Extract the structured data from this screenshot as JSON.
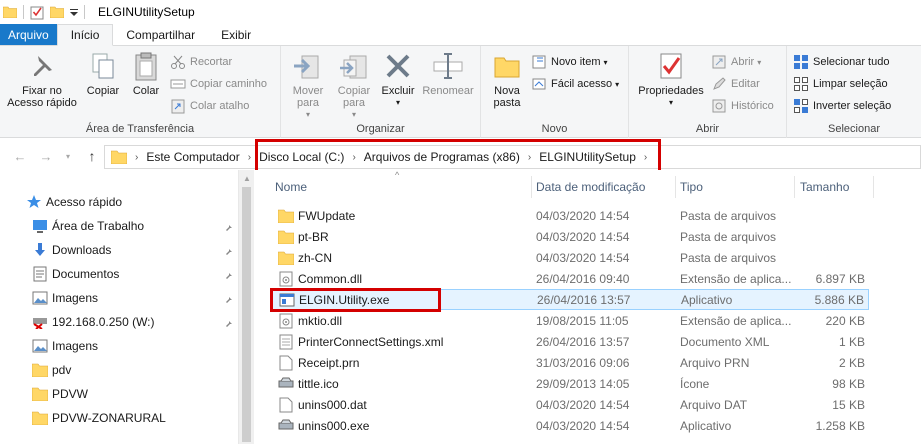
{
  "window": {
    "title": "ELGINUtilitySetup"
  },
  "tabs": [
    {
      "label": "Arquivo"
    },
    {
      "label": "Início"
    },
    {
      "label": "Compartilhar"
    },
    {
      "label": "Exibir"
    }
  ],
  "ribbon": {
    "clipboard": {
      "label": "Área de Transferência",
      "pin_label": "Fixar no Acesso rápido",
      "copy_label": "Copiar",
      "paste_label": "Colar",
      "cut_label": "Recortar",
      "copy_path_label": "Copiar caminho",
      "paste_shortcut_label": "Colar atalho"
    },
    "organize": {
      "label": "Organizar",
      "move_label": "Mover para",
      "copy_to_label": "Copiar para",
      "delete_label": "Excluir",
      "rename_label": "Renomear"
    },
    "new": {
      "label": "Novo",
      "new_folder_label": "Nova pasta",
      "new_item_label": "Novo item",
      "easy_access_label": "Fácil acesso"
    },
    "open": {
      "label": "Abrir",
      "properties_label": "Propriedades",
      "open_label": "Abrir",
      "edit_label": "Editar",
      "history_label": "Histórico"
    },
    "select": {
      "label": "Selecionar",
      "select_all_label": "Selecionar tudo",
      "select_none_label": "Limpar seleção",
      "invert_label": "Inverter seleção"
    }
  },
  "address": {
    "crumbs": [
      "Este Computador",
      "Disco Local (C:)",
      "Arquivos de Programas (x86)",
      "ELGINUtilitySetup"
    ]
  },
  "nav": {
    "quick_access": "Acesso rápido",
    "items": [
      {
        "label": "Área de Trabalho",
        "icon": "desktop-icon",
        "pinned": true
      },
      {
        "label": "Downloads",
        "icon": "download-icon",
        "pinned": true
      },
      {
        "label": "Documentos",
        "icon": "documents-icon",
        "pinned": true
      },
      {
        "label": "Imagens",
        "icon": "pictures-icon",
        "pinned": true
      },
      {
        "label": "192.168.0.250 (W:)",
        "icon": "network-drive-icon",
        "pinned": true
      },
      {
        "label": "Imagens",
        "icon": "pictures-icon",
        "pinned": false
      },
      {
        "label": "pdv",
        "icon": "folder-icon",
        "pinned": false
      },
      {
        "label": "PDVW",
        "icon": "folder-icon",
        "pinned": false
      },
      {
        "label": "PDVW-ZONARURAL",
        "icon": "folder-icon",
        "pinned": false
      }
    ]
  },
  "columns": {
    "name": "Nome",
    "date": "Data de modificação",
    "type": "Tipo",
    "size": "Tamanho"
  },
  "files": [
    {
      "name": "FWUpdate",
      "date": "04/03/2020 14:54",
      "type": "Pasta de arquivos",
      "size": "",
      "icon": "folder-icon"
    },
    {
      "name": "pt-BR",
      "date": "04/03/2020 14:54",
      "type": "Pasta de arquivos",
      "size": "",
      "icon": "folder-icon"
    },
    {
      "name": "zh-CN",
      "date": "04/03/2020 14:54",
      "type": "Pasta de arquivos",
      "size": "",
      "icon": "folder-icon"
    },
    {
      "name": "Common.dll",
      "date": "26/04/2016 09:40",
      "type": "Extensão de aplica...",
      "size": "6.897 KB",
      "icon": "dll-icon"
    },
    {
      "name": "ELGIN.Utility.exe",
      "date": "26/04/2016 13:57",
      "type": "Aplicativo",
      "size": "5.886 KB",
      "icon": "exe-icon",
      "selected": true
    },
    {
      "name": "mktio.dll",
      "date": "19/08/2015 11:05",
      "type": "Extensão de aplica...",
      "size": "220 KB",
      "icon": "dll-icon"
    },
    {
      "name": "PrinterConnectSettings.xml",
      "date": "26/04/2016 13:57",
      "type": "Documento XML",
      "size": "1 KB",
      "icon": "xml-icon"
    },
    {
      "name": "Receipt.prn",
      "date": "31/03/2016 09:06",
      "type": "Arquivo PRN",
      "size": "2 KB",
      "icon": "file-icon"
    },
    {
      "name": "tittle.ico",
      "date": "29/09/2013 14:05",
      "type": "Ícone",
      "size": "98 KB",
      "icon": "ico-icon"
    },
    {
      "name": "unins000.dat",
      "date": "04/03/2020 14:54",
      "type": "Arquivo DAT",
      "size": "15 KB",
      "icon": "file-icon"
    },
    {
      "name": "unins000.exe",
      "date": "04/03/2020 14:54",
      "type": "Aplicativo",
      "size": "1.258 KB",
      "icon": "installer-icon"
    }
  ],
  "colors": {
    "accent": "#1979ca",
    "highlight": "#d40000",
    "folder": "#ffd766",
    "selection": "#e5f3ff"
  }
}
